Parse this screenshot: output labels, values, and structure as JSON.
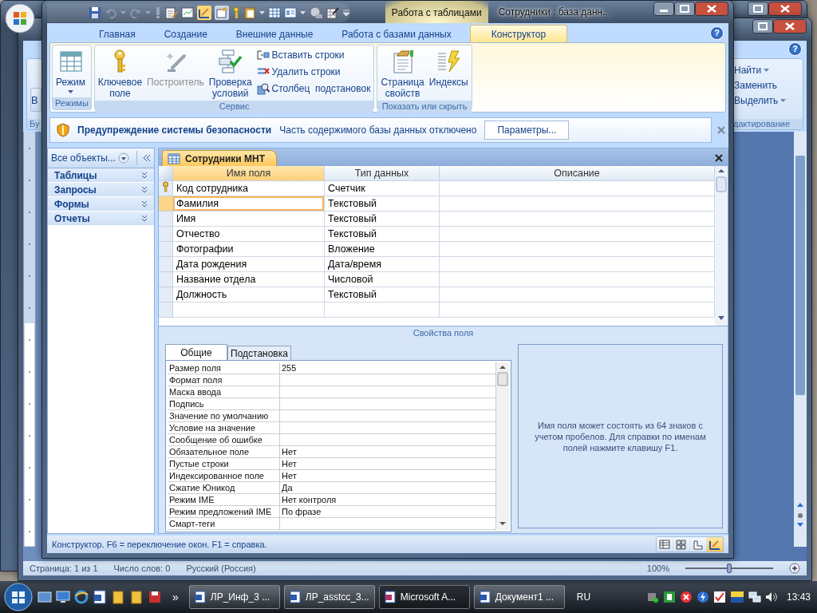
{
  "back_window": {
    "ribbon_button": "В",
    "ribbon_group": "Бу",
    "help_button": "?",
    "editing_commands": [
      {
        "label": "Найти",
        "dropdown": true
      },
      {
        "label": "Заменить",
        "dropdown": false
      },
      {
        "label": "Выделить",
        "dropdown": true
      }
    ],
    "editing_group": "дактирование",
    "status_items": [
      "Страница: 1 из 1",
      "Число слов: 0",
      "Русский (Россия)"
    ],
    "zoom": "100%",
    "zoom_slider": {
      "level": 0.5
    }
  },
  "window": {
    "title": "Сотрудники : база данн...",
    "contextual_tab": "Работа с таблицами",
    "help_button": "?"
  },
  "ribbon_tabs": [
    {
      "label": "Главная",
      "selected": false
    },
    {
      "label": "Создание",
      "selected": false
    },
    {
      "label": "Внешние данные",
      "selected": false
    },
    {
      "label": "Работа с базами данных",
      "selected": false
    },
    {
      "label": "Конструктор",
      "selected": true
    }
  ],
  "ribbon_groups": [
    {
      "label": "Режимы",
      "commands": [
        {
          "kind": "large",
          "label": "Режим",
          "dropdown": true,
          "disabled": false
        }
      ]
    },
    {
      "label": "Сервис",
      "commands": [
        {
          "kind": "large",
          "label": "Ключевое поле",
          "dropdown": false,
          "disabled": false
        },
        {
          "kind": "large",
          "label": "Построитель",
          "dropdown": false,
          "disabled": true
        },
        {
          "kind": "large",
          "label": "Проверка условий",
          "dropdown": false,
          "disabled": false
        },
        {
          "kind": "small",
          "label": "Вставить строки",
          "dropdown": false,
          "disabled": false
        },
        {
          "kind": "small",
          "label": "Удалить строки",
          "dropdown": false,
          "disabled": false
        },
        {
          "kind": "small",
          "label": "Столбец  подстановок",
          "dropdown": false,
          "disabled": false
        }
      ]
    },
    {
      "label": "Показать или скрыть",
      "commands": [
        {
          "kind": "large",
          "label": "Страница свойств",
          "dropdown": false,
          "disabled": false
        },
        {
          "kind": "large",
          "label": "Индексы",
          "dropdown": false,
          "disabled": false
        }
      ]
    }
  ],
  "security_bar": {
    "title": "Предупреждение системы безопасности",
    "message": "Часть содержимого базы данных отключено",
    "button": "Параметры..."
  },
  "nav_pane": {
    "header": "Все объекты...",
    "groups": [
      "Таблицы",
      "Запросы",
      "Формы",
      "Отчеты"
    ]
  },
  "document": {
    "tab": "Сотрудники МНТ",
    "columns": [
      "Имя поля",
      "Тип данных",
      "Описание"
    ],
    "rows": [
      {
        "name": "Код сотрудника",
        "type": "Счетчик",
        "primary_key": true,
        "selected": false
      },
      {
        "name": "Фамилия",
        "type": "Текстовый",
        "primary_key": false,
        "selected": true
      },
      {
        "name": "Имя",
        "type": "Текстовый",
        "primary_key": false,
        "selected": false
      },
      {
        "name": "Отчество",
        "type": "Текстовый",
        "primary_key": false,
        "selected": false
      },
      {
        "name": "Фотографии",
        "type": "Вложение",
        "primary_key": false,
        "selected": false
      },
      {
        "name": "Дата рождения",
        "type": "Дата/время",
        "primary_key": false,
        "selected": false
      },
      {
        "name": "Название отдела",
        "type": "Числовой",
        "primary_key": false,
        "selected": false
      },
      {
        "name": "Должность",
        "type": "Текстовый",
        "primary_key": false,
        "selected": false
      }
    ]
  },
  "properties_caption": "Свойства поля",
  "property_tabs": [
    {
      "label": "Общие",
      "selected": true
    },
    {
      "label": "Подстановка",
      "selected": false
    }
  ],
  "properties": [
    {
      "name": "Размер поля",
      "value": "255"
    },
    {
      "name": "Формат поля"
    },
    {
      "name": "Маска ввода"
    },
    {
      "name": "Подпись"
    },
    {
      "name": "Значение по умолчанию"
    },
    {
      "name": "Условие на значение"
    },
    {
      "name": "Сообщение об ошибке"
    },
    {
      "name": "Обязательное поле",
      "value": "Нет"
    },
    {
      "name": "Пустые строки",
      "value": "Нет"
    },
    {
      "name": "Индексированное поле",
      "value": "Нет"
    },
    {
      "name": "Сжатие Юникод",
      "value": "Да"
    },
    {
      "name": "Режим IME",
      "value": "Нет контроля"
    },
    {
      "name": "Режим предложений IME",
      "value": "По фразе"
    },
    {
      "name": "Смарт-теги"
    }
  ],
  "help_text": "Имя поля может состоять из 64 знаков с учетом пробелов.  Для справки по именам полей нажмите клавишу F1.",
  "status_bar": {
    "text": "Конструктор.  F6 = переключение окон.  F1 = справка.",
    "views": [
      {
        "selected": false
      },
      {
        "selected": false
      },
      {
        "selected": false
      },
      {
        "selected": true
      }
    ]
  },
  "taskbar": {
    "overflow": "»",
    "language": "RU",
    "clock": "13:43",
    "tasks": [
      {
        "label": "ЛР_Инф_3 ...",
        "selected": false
      },
      {
        "label": "ЛР_asstcc_3...",
        "selected": false
      },
      {
        "label": "Microsoft A...",
        "selected": true
      },
      {
        "label": "Документ1 ...",
        "selected": false
      }
    ]
  }
}
